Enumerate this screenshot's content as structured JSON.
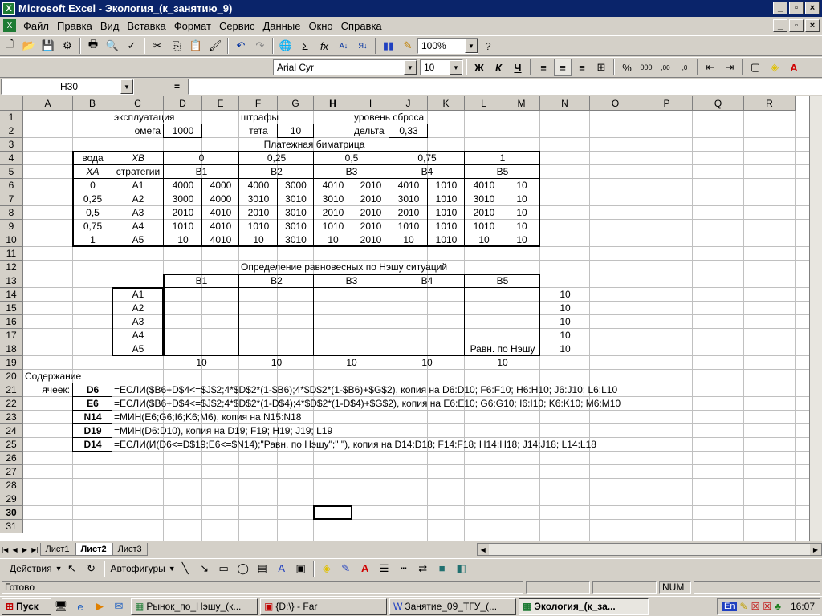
{
  "title": "Microsoft Excel - Экология_(к_занятию_9)",
  "menu": [
    "Файл",
    "Правка",
    "Вид",
    "Вставка",
    "Формат",
    "Сервис",
    "Данные",
    "Окно",
    "Справка"
  ],
  "toolbar": {
    "zoom": "100%",
    "font": "Arial Cyr",
    "size": "10"
  },
  "namebox": "H30",
  "formula_eq": "=",
  "columns": [
    "A",
    "B",
    "C",
    "D",
    "E",
    "F",
    "G",
    "H",
    "I",
    "J",
    "K",
    "L",
    "M",
    "N",
    "O",
    "P",
    "Q",
    "R"
  ],
  "rows": [
    "1",
    "2",
    "3",
    "4",
    "5",
    "6",
    "7",
    "8",
    "9",
    "10",
    "11",
    "12",
    "13",
    "14",
    "15",
    "16",
    "17",
    "18",
    "19",
    "20",
    "21",
    "22",
    "23",
    "24",
    "25",
    "26",
    "27",
    "28",
    "29",
    "30",
    "31"
  ],
  "cells": {
    "exploit": "эксплуатация",
    "fines": "штрафы",
    "reset": "уровень сброса",
    "omega": "омега",
    "omega_v": "1000",
    "teta": "тета",
    "teta_v": "10",
    "delta": "дельта",
    "delta_v": "0,33",
    "title1": "Платежная биматрица",
    "water": "вода",
    "xb": "XB",
    "xa": "XA",
    "strategies": "стратегии",
    "hdr4": [
      "0",
      "0,25",
      "0,5",
      "0,75",
      "1"
    ],
    "b": [
      "B1",
      "B2",
      "B3",
      "B4",
      "B5"
    ],
    "xa_vals": [
      "0",
      "0,25",
      "0,5",
      "0,75",
      "1"
    ],
    "a": [
      "A1",
      "A2",
      "A3",
      "A4",
      "A5"
    ],
    "matrix": [
      [
        "4000",
        "4000",
        "4000",
        "3000",
        "4010",
        "2010",
        "4010",
        "1010",
        "4010",
        "10"
      ],
      [
        "3000",
        "4000",
        "3010",
        "3010",
        "3010",
        "2010",
        "3010",
        "1010",
        "3010",
        "10"
      ],
      [
        "2010",
        "4010",
        "2010",
        "3010",
        "2010",
        "2010",
        "2010",
        "1010",
        "2010",
        "10"
      ],
      [
        "1010",
        "4010",
        "1010",
        "3010",
        "1010",
        "2010",
        "1010",
        "1010",
        "1010",
        "10"
      ],
      [
        "10",
        "4010",
        "10",
        "3010",
        "10",
        "2010",
        "10",
        "1010",
        "10",
        "10"
      ]
    ],
    "title2": "Определение равновесных по Нэшу ситуаций",
    "n_vals": [
      "10",
      "10",
      "10",
      "10",
      "10"
    ],
    "nash": "Равн. по Нэшу",
    "row19": [
      "10",
      "10",
      "10",
      "10",
      "10"
    ],
    "content": "Содержание",
    "cells_lbl": "ячеек:",
    "refs": [
      "D6",
      "E6",
      "N14",
      "D19",
      "D14"
    ],
    "formulas": [
      "=ЕСЛИ($B6+D$4<=$J$2;4*$D$2*(1-$B6);4*$D$2*(1-$B6)+$G$2), копия на D6:D10; F6:F10; H6:H10; J6:J10; L6:L10",
      "=ЕСЛИ($B6+D$4<=$J$2;4*$D$2*(1-D$4);4*$D$2*(1-D$4)+$G$2), копия на E6:E10; G6:G10; I6:I10; K6:K10; M6:M10",
      "=МИН(E6;G6;I6;K6;M6), копия на N15:N18",
      "=МИН(D6:D10), копия на D19; F19; H19; J19; L19",
      "=ЕСЛИ(И(D6<=D$19;E6<=$N14);\"Равн. по Нэшу\";\" \"), копия на D14:D18; F14:F18; H14:H18; J14:J18; L14:L18"
    ]
  },
  "sheets": [
    "Лист1",
    "Лист2",
    "Лист3"
  ],
  "drawbar": {
    "actions": "Действия",
    "autoshapes": "Автофигуры"
  },
  "status": {
    "ready": "Готово",
    "num": "NUM"
  },
  "taskbar": {
    "start": "Пуск",
    "items": [
      "Рынок_по_Нэшу_(к...",
      "{D:\\} - Far",
      "Занятие_09_ТГУ_(...",
      "Экология_(к_за..."
    ],
    "lang": "En",
    "clock": "16:07"
  }
}
